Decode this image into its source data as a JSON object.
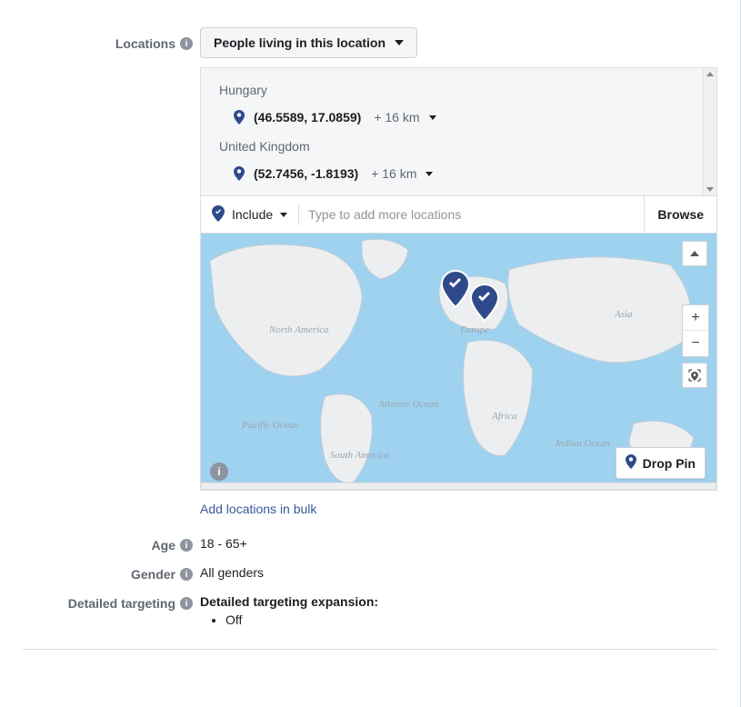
{
  "locations": {
    "label": "Locations",
    "filter_dropdown": "People living in this location",
    "items": [
      {
        "country": "Hungary",
        "coords": "(46.5589, 17.0859)",
        "radius": "+ 16 km"
      },
      {
        "country": "United Kingdom",
        "coords": "(52.7456, -1.8193)",
        "radius": "+ 16 km"
      }
    ],
    "include_mode": "Include",
    "search_placeholder": "Type to add more locations",
    "browse_label": "Browse",
    "drop_pin_label": "Drop Pin",
    "bulk_link": "Add locations in bulk",
    "map_labels": {
      "north_america": "North America",
      "south_america": "South America",
      "europe": "Europe",
      "africa": "Africa",
      "asia": "Asia",
      "pacific": "Pacific Ocean",
      "atlantic": "Atlantic Ocean",
      "indian": "Indian Ocean"
    }
  },
  "age": {
    "label": "Age",
    "value": "18 - 65+"
  },
  "gender": {
    "label": "Gender",
    "value": "All genders"
  },
  "detailed_targeting": {
    "label": "Detailed targeting",
    "expansion_header": "Detailed targeting expansion:",
    "expansion_value": "Off"
  }
}
